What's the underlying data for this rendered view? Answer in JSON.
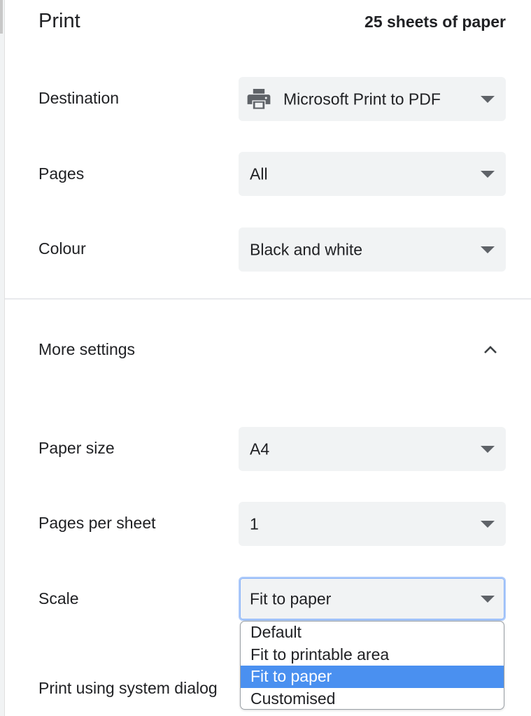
{
  "header": {
    "title": "Print",
    "sheets": "25 sheets of paper"
  },
  "destination": {
    "label": "Destination",
    "value": "Microsoft Print to PDF",
    "icon": "printer-icon"
  },
  "pages": {
    "label": "Pages",
    "value": "All"
  },
  "colour": {
    "label": "Colour",
    "value": "Black and white"
  },
  "more_settings": {
    "label": "More settings",
    "icon": "chevron-up-icon"
  },
  "paper_size": {
    "label": "Paper size",
    "value": "A4"
  },
  "pages_per_sheet": {
    "label": "Pages per sheet",
    "value": "1"
  },
  "scale": {
    "label": "Scale",
    "value": "Fit to paper",
    "options": [
      "Default",
      "Fit to printable area",
      "Fit to paper",
      "Customised"
    ],
    "selected_index": 2
  },
  "system_dialog": {
    "label": "Print using system dialog"
  },
  "colors": {
    "select_bg": "#f1f3f4",
    "highlight": "#4a90f0",
    "text": "#202124"
  }
}
